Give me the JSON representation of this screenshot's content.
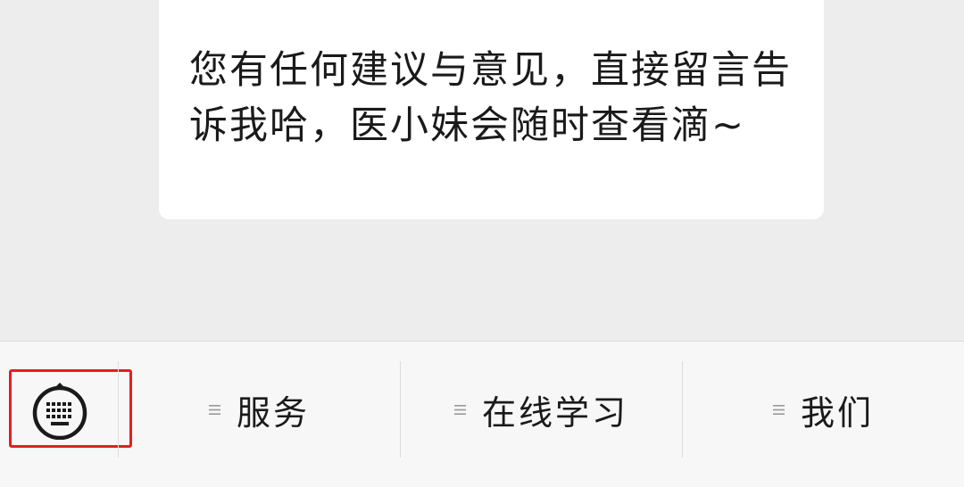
{
  "chat": {
    "message": "您有任何建议与意见，直接留言告诉我哈，医小妹会随时查看滴~"
  },
  "menu": {
    "items": [
      {
        "label": "服务",
        "icon": "menu-lines-icon"
      },
      {
        "label": "在线学习",
        "icon": "menu-lines-icon"
      },
      {
        "label": "我们",
        "icon": "menu-lines-icon"
      }
    ],
    "toggle_icon": "keyboard-icon",
    "highlight_color": "#e02020"
  }
}
